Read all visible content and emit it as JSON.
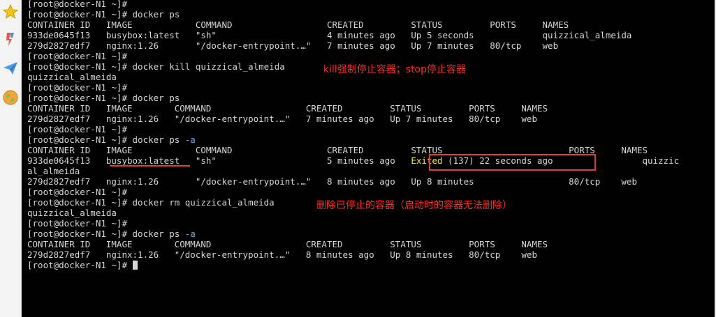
{
  "sidebar": {
    "icons": [
      "star-icon",
      "bookmark-ribbon-icon",
      "paper-plane-icon",
      "globe-icon"
    ]
  },
  "terminal": {
    "lines": [
      "[root@docker-N1 ~]#",
      "[root@docker-N1 ~]# docker ps",
      "CONTAINER ID   IMAGE            COMMAND                  CREATED         STATUS         PORTS     NAMES",
      "933de0645f13   busybox:latest   \"sh\"                     4 minutes ago   Up 5 seconds             quizzical_almeida",
      "279d2827edf7   nginx:1.26       \"/docker-entrypoint.…\"   7 minutes ago   Up 7 minutes   80/tcp    web",
      "[root@docker-N1 ~]#",
      "[root@docker-N1 ~]# docker kill quizzical_almeida",
      "quizzical_almeida",
      "[root@docker-N1 ~]#",
      "[root@docker-N1 ~]# docker ps",
      "CONTAINER ID   IMAGE        COMMAND                  CREATED         STATUS         PORTS     NAMES",
      "279d2827edf7   nginx:1.26   \"/docker-entrypoint.…\"   7 minutes ago   Up 7 minutes   80/tcp    web",
      "[root@docker-N1 ~]#",
      {
        "prefix": "[root@docker-N1 ~]# docker ps ",
        "flag": "-a"
      },
      "CONTAINER ID   IMAGE            COMMAND                  CREATED         STATUS                        PORTS     NAMES",
      {
        "prefix": "933de0645f13   busybox:latest   \"sh\"                     5 minutes ago   ",
        "exited": "Exited",
        "suffix": " (137) 22 seconds ago                 quizzic"
      },
      "al_almeida",
      "279d2827edf7   nginx:1.26       \"/docker-entrypoint.…\"   8 minutes ago   Up 8 minutes                  80/tcp    web",
      "[root@docker-N1 ~]#",
      "[root@docker-N1 ~]# docker rm quizzical_almeida",
      "quizzical_almeida",
      "[root@docker-N1 ~]#",
      {
        "prefix": "[root@docker-N1 ~]# docker ps ",
        "flag": "-a"
      },
      "CONTAINER ID   IMAGE        COMMAND                  CREATED         STATUS         PORTS     NAMES",
      "279d2827edf7   nginx:1.26   \"/docker-entrypoint.…\"   8 minutes ago   Up 8 minutes   80/tcp    web",
      {
        "prefix": "[root@docker-N1 ~]# ",
        "cursor": true
      }
    ]
  },
  "annotations": {
    "kill_note": "kill强制停止容器；stop停止容器",
    "rm_note": "删除已停止的容器（启动时的容器无法删除）"
  },
  "colors": {
    "terminal_bg": "#000000",
    "terminal_fg": "#d6d6d6",
    "flag": "#5fb0ff",
    "exited": "#f1e84a",
    "annotation": "#ff2a2a",
    "highlight_box": "#e53935"
  }
}
